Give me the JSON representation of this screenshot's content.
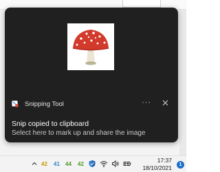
{
  "toast": {
    "app_name": "Snipping Tool",
    "more_glyph": "···",
    "title": "Snip copied to clipboard",
    "body": "Select here to mark up and share the image",
    "thumbnail_icon": "mushroom-image",
    "accent": "#d23a2c"
  },
  "taskbar": {
    "temperatures": [
      "42",
      "41",
      "44",
      "42"
    ],
    "time": "17:37",
    "date": "18/10/2021",
    "notification_count": "1",
    "icons": [
      "chevron-up-icon",
      "shield-icon",
      "wifi-icon",
      "volume-icon",
      "battery-icon"
    ]
  }
}
